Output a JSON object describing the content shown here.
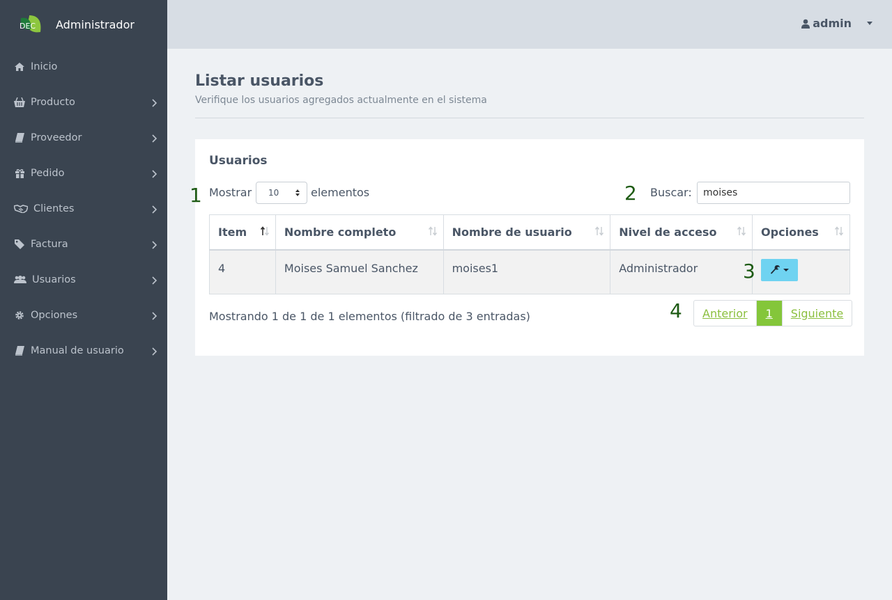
{
  "brand": {
    "title": "Administrador",
    "logo_text": "DEC"
  },
  "sidebar": {
    "items": [
      {
        "label": "Inicio",
        "icon": "home-icon",
        "has_submenu": false
      },
      {
        "label": "Producto",
        "icon": "basket-icon",
        "has_submenu": true
      },
      {
        "label": "Proveedor",
        "icon": "book-icon",
        "has_submenu": true
      },
      {
        "label": "Pedido",
        "icon": "gift-icon",
        "has_submenu": true
      },
      {
        "label": "Clientes",
        "icon": "handshake-icon",
        "has_submenu": true
      },
      {
        "label": "Factura",
        "icon": "tag-icon",
        "has_submenu": true
      },
      {
        "label": "Usuarios",
        "icon": "users-icon",
        "has_submenu": true
      },
      {
        "label": "Opciones",
        "icon": "gear-icon",
        "has_submenu": true
      },
      {
        "label": "Manual de usuario",
        "icon": "book-icon",
        "has_submenu": true
      }
    ]
  },
  "topbar": {
    "user": "admin"
  },
  "page": {
    "title": "Listar usuarios",
    "subtitle": "Verifique los usuarios agregados actualmente en el sistema"
  },
  "card": {
    "title": "Usuarios",
    "length_label": "Mostrar",
    "length_value": "10",
    "length_suffix": "elementos",
    "search_label": "Buscar:",
    "search_value": "moises"
  },
  "table": {
    "headers": [
      "Item",
      "Nombre completo",
      "Nombre de usuario",
      "Nivel de acceso",
      "Opciones"
    ],
    "rows": [
      {
        "item": "4",
        "nombre": "Moises Samuel Sanchez",
        "usuario": "moises1",
        "nivel": "Administrador"
      }
    ]
  },
  "info": "Mostrando 1 de 1 de 1 elementos (filtrado de 3 entradas)",
  "pagination": {
    "prev": "Anterior",
    "current": "1",
    "next": "Siguiente"
  },
  "markers": [
    "1",
    "2",
    "3",
    "4"
  ],
  "colors": {
    "sidebar": "#3a4450",
    "accent_green": "#84c63a",
    "options_button": "#6fd3f1",
    "marker": "#1e5b14"
  }
}
